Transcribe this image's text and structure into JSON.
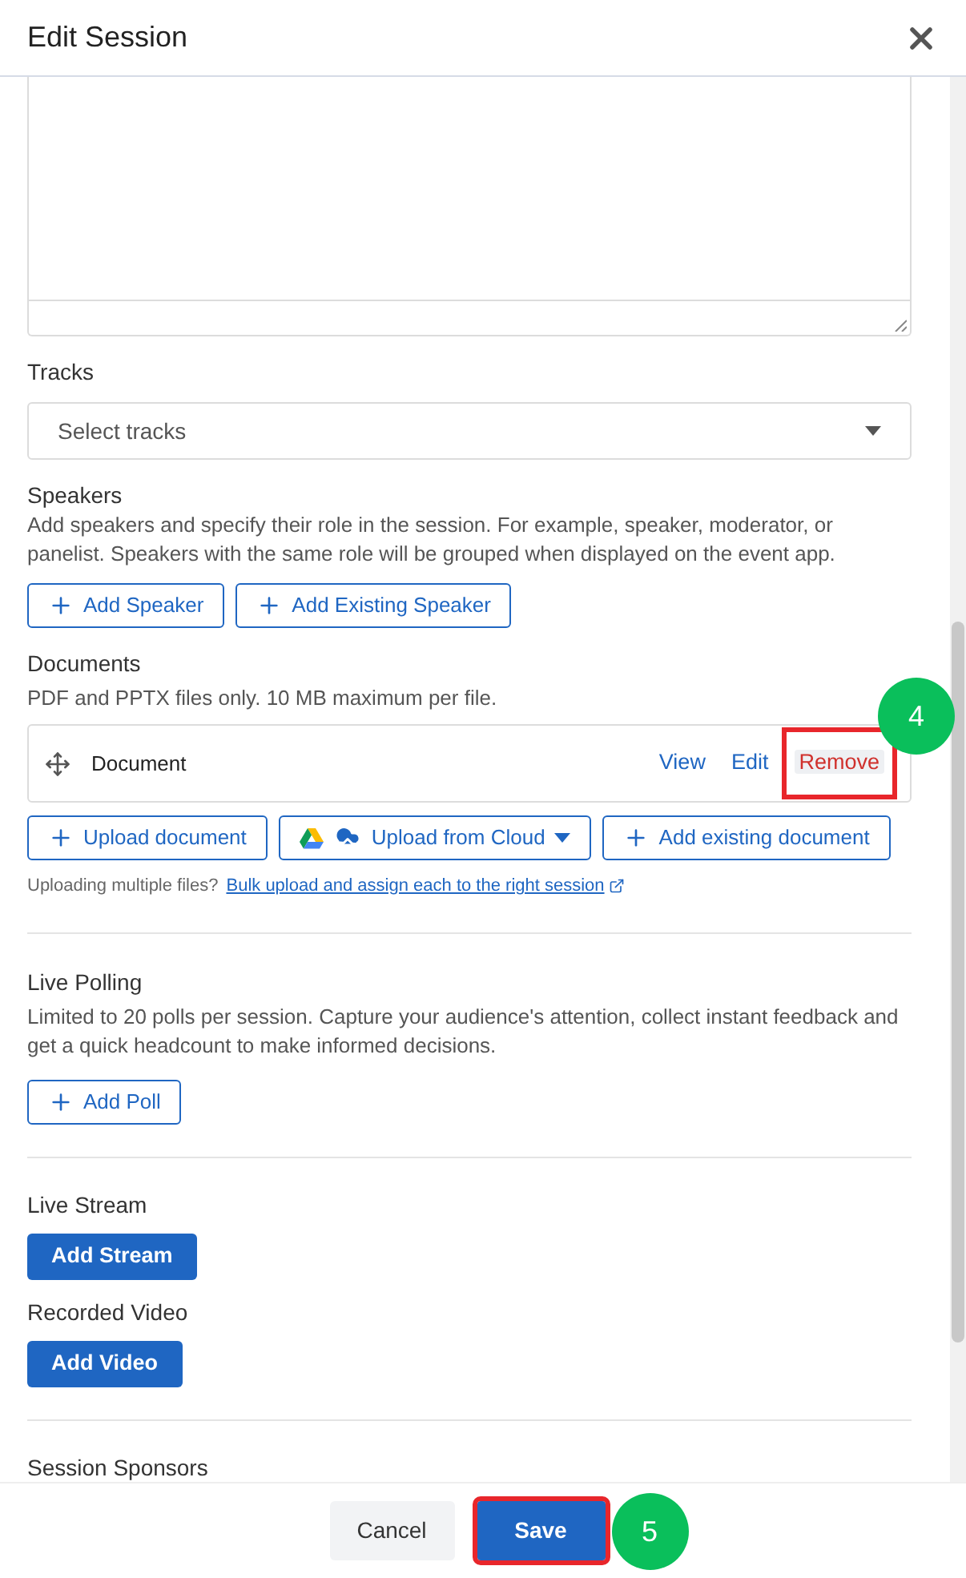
{
  "dialog": {
    "title": "Edit Session"
  },
  "tracks": {
    "label": "Tracks",
    "placeholder": "Select tracks"
  },
  "speakers": {
    "label": "Speakers",
    "description": "Add speakers and specify their role in the session. For example, speaker, moderator, or panelist. Speakers with the same role will be grouped when displayed on the event app.",
    "buttons": [
      "Add Speaker",
      "Add Existing Speaker"
    ]
  },
  "documents": {
    "label": "Documents",
    "description": "PDF and PPTX files only. 10 MB maximum per file.",
    "items": [
      {
        "name": "Document",
        "actions": [
          {
            "label": "View",
            "kind": "link",
            "highlighted": false
          },
          {
            "label": "Edit",
            "kind": "link",
            "highlighted": false
          },
          {
            "label": "Remove",
            "kind": "danger",
            "highlighted": true
          }
        ]
      }
    ],
    "step_marker": "4",
    "buttons": [
      {
        "label": "Upload document",
        "kind": "add"
      },
      {
        "label": "Upload from Cloud",
        "kind": "cloud"
      },
      {
        "label": "Add existing document",
        "kind": "add"
      }
    ],
    "hint": "Uploading multiple files?",
    "link": "Bulk upload and assign each to the right session"
  },
  "live_polling": {
    "label": "Live Polling",
    "description": "Limited to 20 polls per session. Capture your audience's attention, collect instant feedback and get a quick headcount to make informed decisions.",
    "button": "Add Poll"
  },
  "live_stream": {
    "label": "Live Stream",
    "button": "Add Stream"
  },
  "recorded_video": {
    "label": "Recorded Video",
    "button": "Add Video"
  },
  "session_sponsors": {
    "label": "Session Sponsors"
  },
  "footer": {
    "cancel": "Cancel",
    "save": {
      "label": "Save",
      "highlighted": true
    },
    "step_marker": "5"
  }
}
